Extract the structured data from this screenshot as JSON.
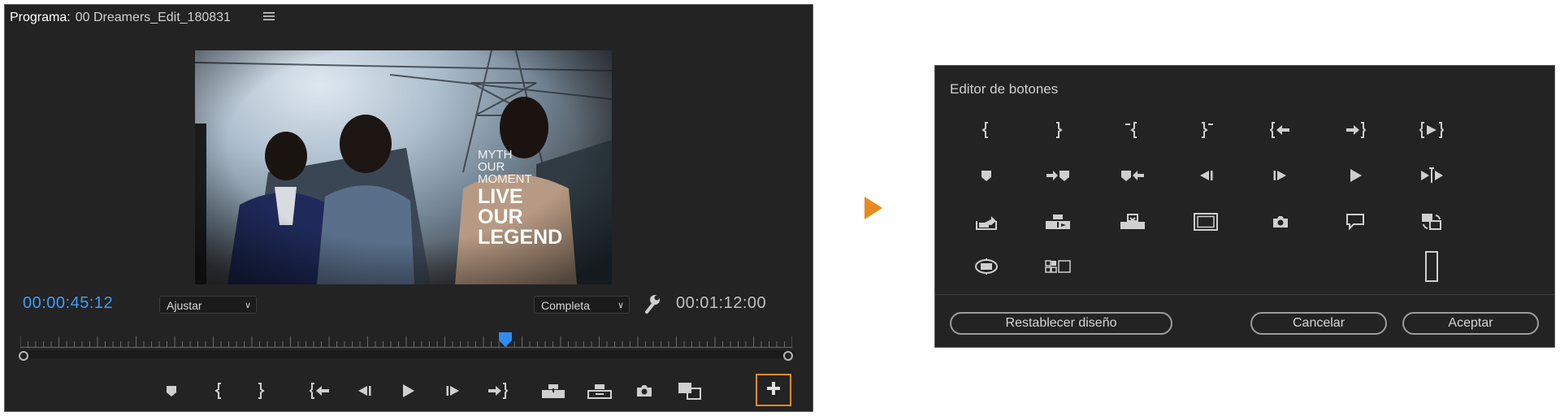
{
  "monitor": {
    "label": "Programa:",
    "sequence_name": "00 Dreamers_Edit_180831",
    "menu_icon": "hamburger-icon",
    "video_overlay_lines": [
      "MYTH",
      "OUR",
      "MOMENT",
      "LIVE",
      "OUR",
      "LEGEND"
    ],
    "timecode_current": "00:00:45:12",
    "timecode_duration": "00:01:12:00",
    "zoom_select": "Ajustar",
    "resolution_select": "Completa",
    "accent_color": "#3d9df7",
    "highlight_color": "#e88b1f",
    "transport_icons": [
      "marker-icon",
      "mark-in-icon",
      "mark-out-icon",
      "go-to-in-icon",
      "step-back-icon",
      "play-icon",
      "step-forward-icon",
      "go-to-out-icon",
      "lift-icon",
      "extract-icon",
      "export-frame-icon",
      "comparison-view-icon",
      "button-editor-plus-icon"
    ]
  },
  "editor": {
    "title": "Editor de botones",
    "buttons": {
      "reset": "Restablecer diseño",
      "cancel": "Cancelar",
      "accept": "Aceptar"
    }
  }
}
